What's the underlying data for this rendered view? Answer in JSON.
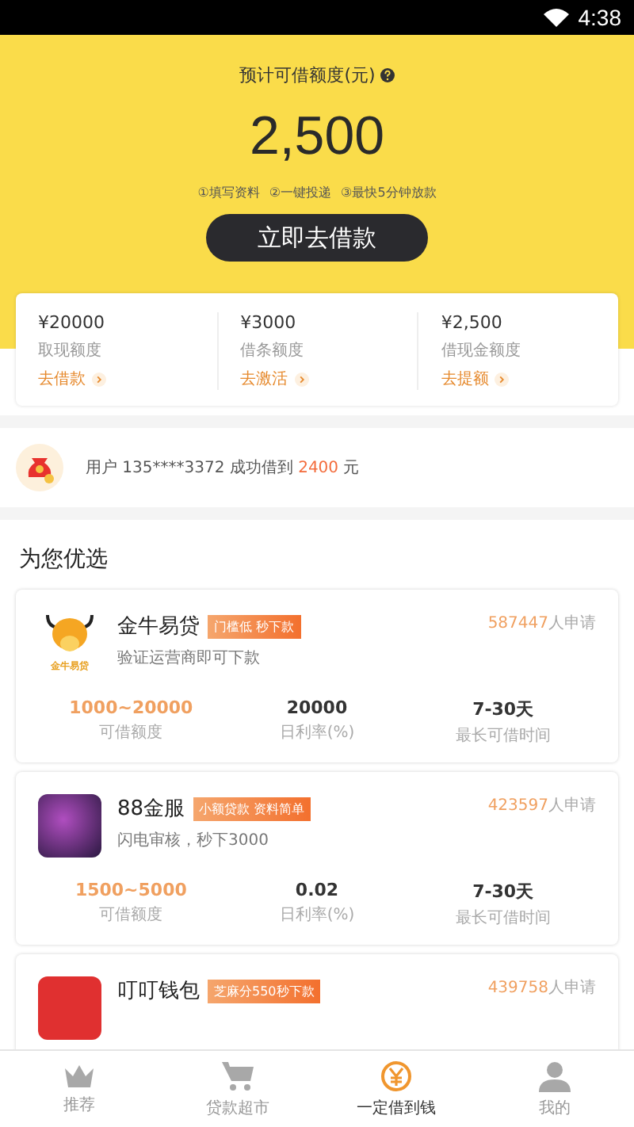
{
  "status_bar": {
    "time": "4:38"
  },
  "header": {
    "label": "预计可借额度(元)",
    "amount": "2,500",
    "steps": [
      "①填写资料",
      "②一键投递",
      "③最快5分钟放款"
    ],
    "button": "立即去借款"
  },
  "quotas": [
    {
      "amount": "¥20000",
      "label": "取现额度",
      "link": "去借款"
    },
    {
      "amount": "¥3000",
      "label": "借条额度",
      "link": "去激活"
    },
    {
      "amount": "¥2,500",
      "label": "借现金额度",
      "link": "去提额"
    }
  ],
  "ticker": {
    "prefix": "用户 135****3372 成功借到 ",
    "amount": "2400",
    "suffix": " 元"
  },
  "section_title": "为您优选",
  "products": [
    {
      "kind": "bull",
      "logo_text": "金牛易贷",
      "name": "金牛易贷",
      "tag": "门槛低 秒下款",
      "count": "587447",
      "count_suffix": "人申请",
      "desc": "验证运营商即可下款",
      "stats": [
        {
          "value": "1000~20000",
          "label": "可借额度"
        },
        {
          "value": "20000",
          "label": "日利率(%)"
        },
        {
          "value": "7-30天",
          "label": "最长可借时间"
        }
      ]
    },
    {
      "kind": "purple",
      "name": "88金服",
      "tag": "小额贷款 资料简单",
      "count": "423597",
      "count_suffix": "人申请",
      "desc": "闪电审核，秒下3000",
      "stats": [
        {
          "value": "1500~5000",
          "label": "可借额度"
        },
        {
          "value": "0.02",
          "label": "日利率(%)"
        },
        {
          "value": "7-30天",
          "label": "最长可借时间"
        }
      ]
    },
    {
      "kind": "red",
      "name": "叮叮钱包",
      "tag": "芝麻分550秒下款",
      "count": "439758",
      "count_suffix": "人申请"
    }
  ],
  "tabs": [
    {
      "kind": "crown",
      "label": "推荐",
      "selected": false
    },
    {
      "kind": "cart",
      "label": "贷款超市",
      "selected": false
    },
    {
      "kind": "yen",
      "label": "一定借到钱",
      "selected": true
    },
    {
      "kind": "person",
      "label": "我的",
      "selected": false
    }
  ]
}
